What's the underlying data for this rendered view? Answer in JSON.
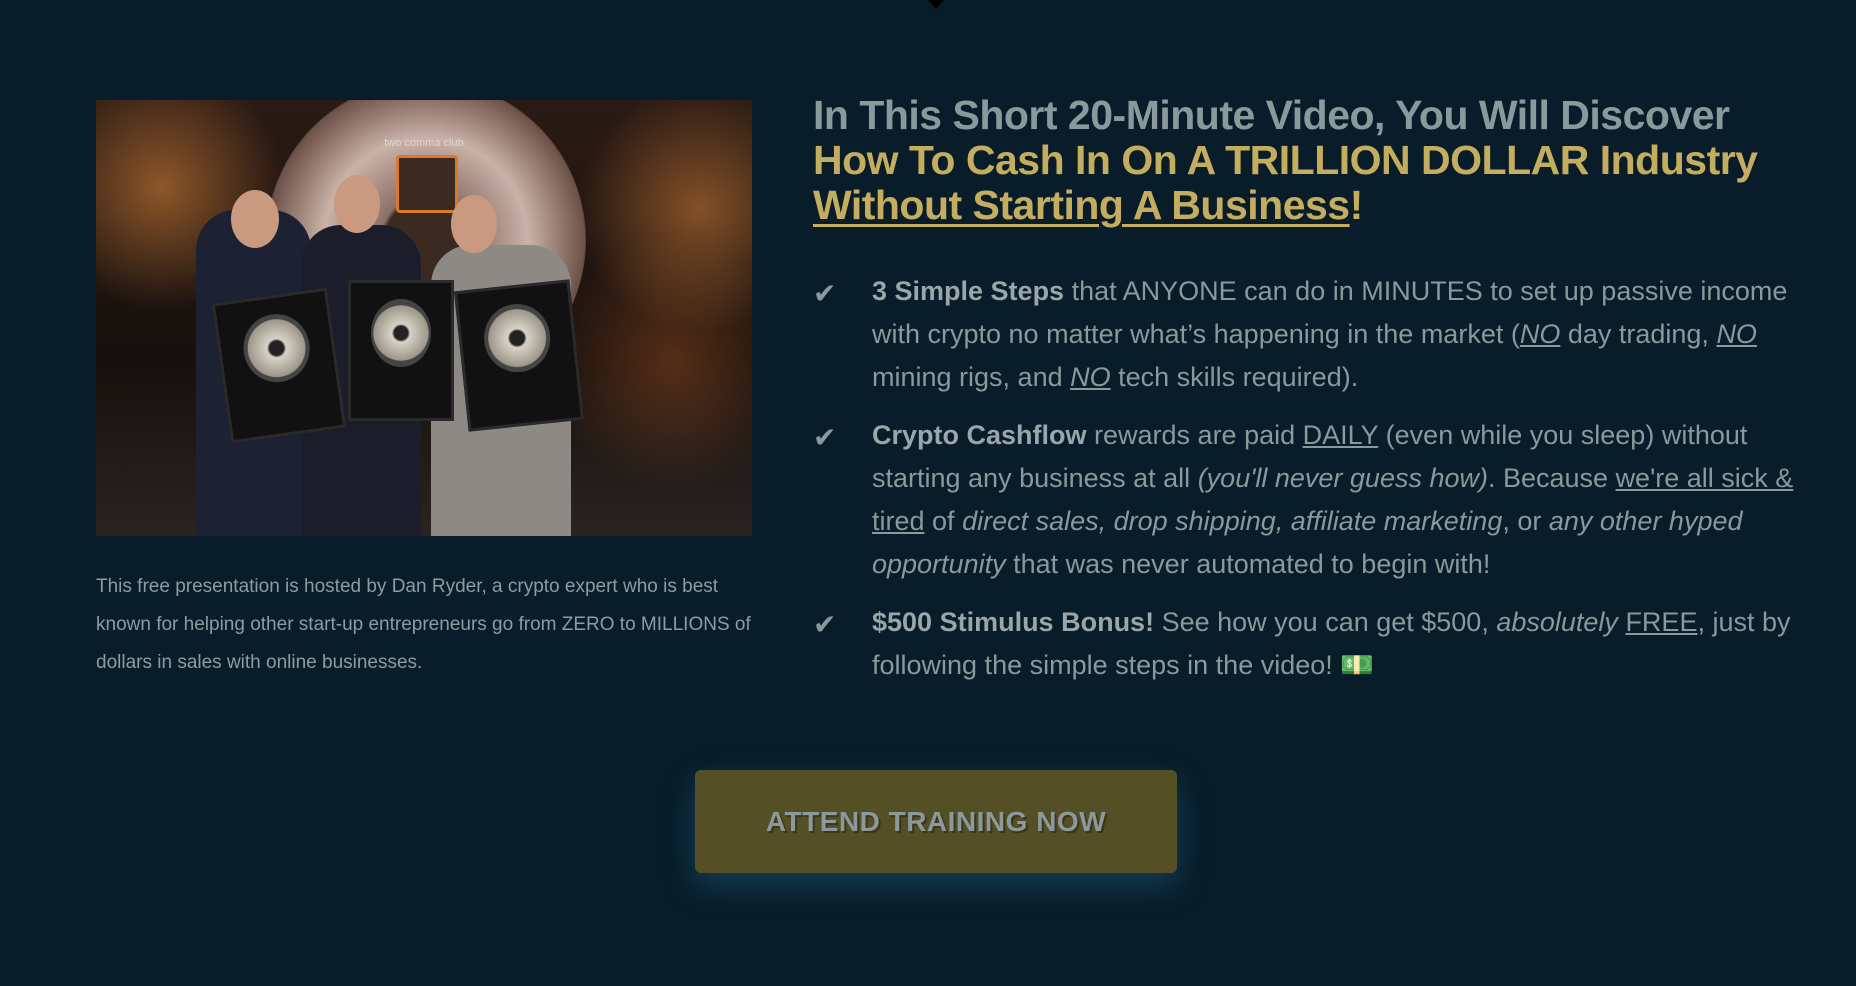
{
  "hero_image": {
    "alt_logo_text": "two comma club"
  },
  "caption": "This free presentation is hosted by Dan Ryder, a crypto expert who is best known for helping other start-up entrepreneurs go from ZERO to MILLIONS of dollars in sales with online businesses.",
  "headline": {
    "part1": "In This Short 20-Minute Video, You Will Discover ",
    "part2": "How To Cash In On A TRILLION DOLLAR Industry ",
    "part3": "Without Starting A Business",
    "part4": "!"
  },
  "bullets": [
    {
      "bold": "3 Simple Steps",
      "t1": " that ANYONE can do in MINUTES to set up passive income with crypto no matter what’s happening in the market (",
      "no1": "NO",
      "t2": " day trading, ",
      "no2": "NO",
      "t3": " mining rigs, and ",
      "no3": "NO",
      "t4": " tech skills required)."
    },
    {
      "bold": "Crypto Cashflow",
      "t1": " rewards are paid ",
      "daily": "DAILY",
      "t2": " (even while you sleep) without starting any business at all ",
      "i1": "(you'll never guess how)",
      "t3": ". Because ",
      "u1": "we're all sick & tired",
      "t4": " of ",
      "i2": "direct sales, drop shipping, affiliate marketing",
      "t5": ", or ",
      "i3": "any other hyped opportunity",
      "t6": " that was never automated to begin with!"
    },
    {
      "bold": "$500 Stimulus Bonus!",
      "t1": " See how you can get $500, ",
      "i1": "absolutely",
      "t2": " ",
      "free": "FREE",
      "t3": ", just by following the simple steps in the video! ",
      "emoji": "💵"
    }
  ],
  "cta_label": "ATTEND TRAINING NOW",
  "colors": {
    "background": "#081d29",
    "gold": "#c4ad5e",
    "button": "#554f25",
    "text": "#8b989c"
  }
}
